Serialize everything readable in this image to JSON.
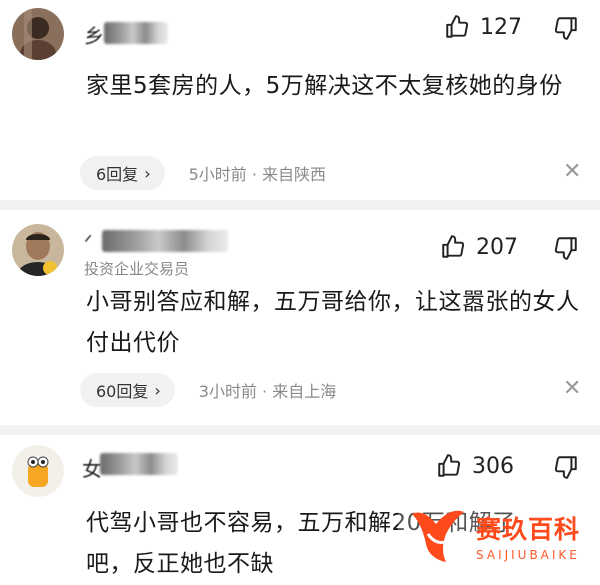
{
  "comments": [
    {
      "name_visible_char": "乡",
      "likes": "127",
      "text": "家里5套房的人，5万解决这不太复核她的身份",
      "replies": "6回复",
      "meta": "5小时前 · 来自陕西"
    },
    {
      "name_visible_char": "ᐟ",
      "tag": "投资企业交易员",
      "likes": "207",
      "text": "小哥别答应和解，五万哥给你，让这嚣张的女人付出代价",
      "replies": "60回复",
      "meta": "3小时前 · 来自上海"
    },
    {
      "name_visible_char": "女",
      "likes": "306",
      "text": "代驾小哥也不容易，五万和解20万和解了吧，反正她也不缺"
    }
  ],
  "watermark": {
    "title": "赛玖百科",
    "subtitle": "SAIJIUBAIKE"
  },
  "colors": {
    "accent": "#ff4a1c",
    "divider": "#f2f2f2",
    "muted": "#8a8a8a"
  },
  "icons": [
    "thumbs-up-icon",
    "thumbs-down-icon",
    "close-icon",
    "chevron-right-icon"
  ]
}
